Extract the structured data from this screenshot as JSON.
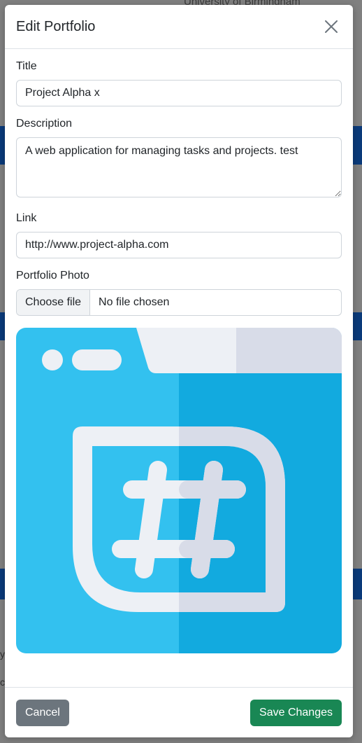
{
  "background": {
    "partial_text": "University of Birmingham",
    "stray_chars": [
      "y",
      "c"
    ]
  },
  "modal": {
    "title": "Edit Portfolio",
    "close_icon": "close-icon",
    "fields": {
      "title_label": "Title",
      "title_value": "Project Alpha x",
      "description_label": "Description",
      "description_value": "A web application for managing tasks and projects. test",
      "link_label": "Link",
      "link_value": "http://www.project-alpha.com",
      "photo_label": "Portfolio Photo",
      "file_button": "Choose file",
      "file_status": "No file chosen"
    },
    "preview_icon": "hashtag-folder-icon",
    "footer": {
      "cancel_label": "Cancel",
      "save_label": "Save Changes"
    }
  },
  "colors": {
    "save_button": "#198754",
    "cancel_button": "#6c757d",
    "preview_blue": "#33c1ef",
    "preview_blue_dark": "#12aadf"
  }
}
